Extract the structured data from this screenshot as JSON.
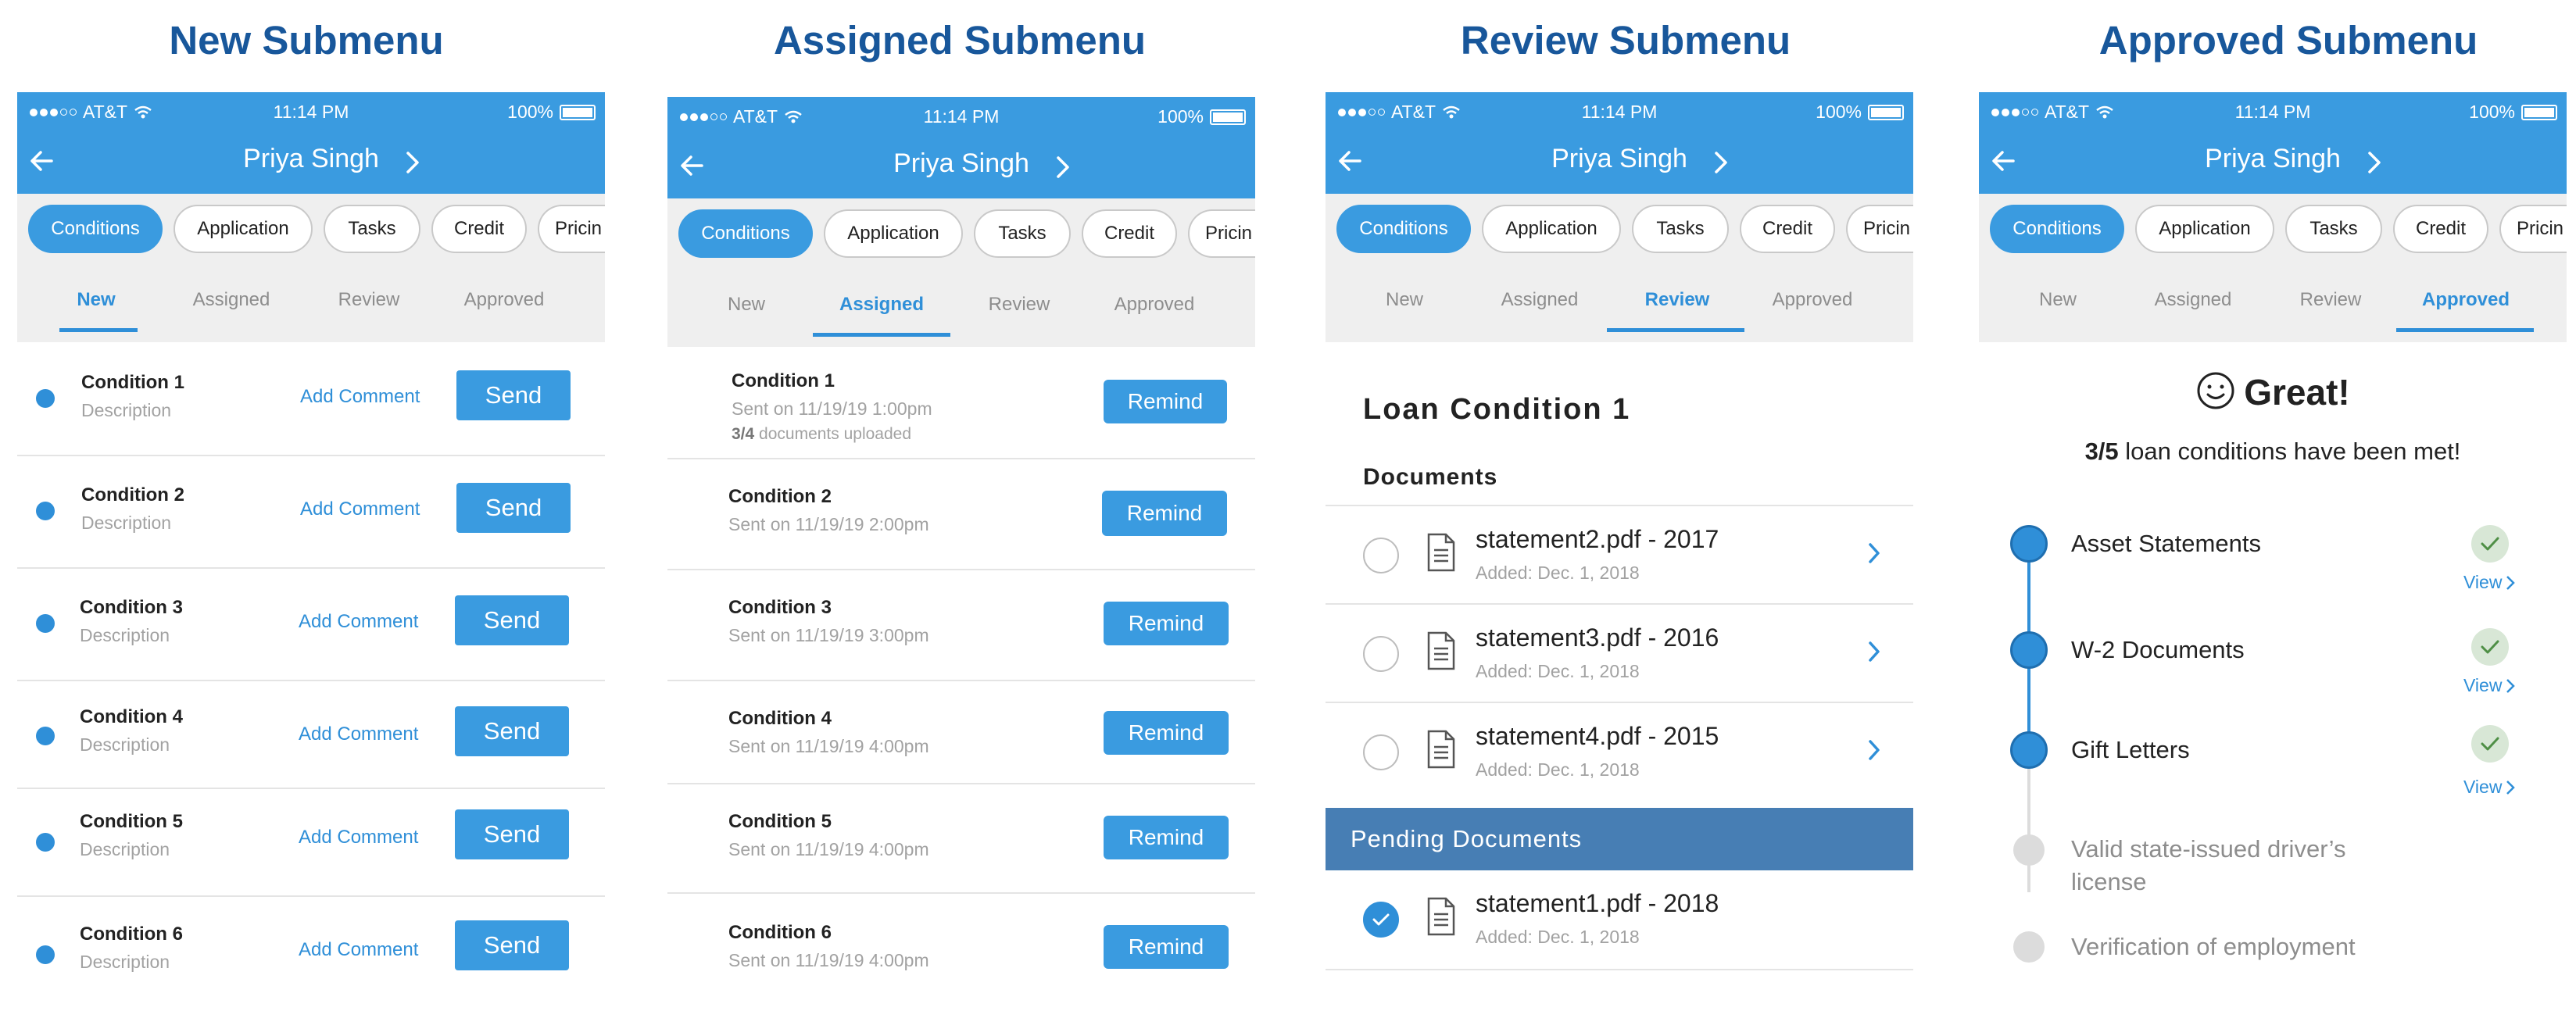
{
  "sections": {
    "new": "New Submenu",
    "assigned": "Assigned Submenu",
    "review": "Review Submenu",
    "approved": "Approved Submenu"
  },
  "status": {
    "carrier": "AT&T",
    "time": "11:14 PM",
    "battery": "100%"
  },
  "header": {
    "name": "Priya Singh"
  },
  "chips": [
    "Conditions",
    "Application",
    "Tasks",
    "Credit",
    "Pricin"
  ],
  "subtabs": [
    "New",
    "Assigned",
    "Review",
    "Approved"
  ],
  "new_panel": {
    "add_comment": "Add Comment",
    "send": "Send",
    "items": [
      {
        "name": "Condition 1",
        "desc": "Description"
      },
      {
        "name": "Condition 2",
        "desc": "Description"
      },
      {
        "name": "Condition 3",
        "desc": "Description"
      },
      {
        "name": "Condition 4",
        "desc": "Description"
      },
      {
        "name": "Condition 5",
        "desc": "Description"
      },
      {
        "name": "Condition 6",
        "desc": "Description"
      }
    ]
  },
  "assigned_panel": {
    "remind": "Remind",
    "items": [
      {
        "name": "Condition 1",
        "sent": "Sent on 11/19/19 1:00pm",
        "count": "3/4",
        "uploaded": "documents uploaded"
      },
      {
        "name": "Condition 2",
        "sent": "Sent on 11/19/19 2:00pm"
      },
      {
        "name": "Condition 3",
        "sent": "Sent on 11/19/19 3:00pm"
      },
      {
        "name": "Condition 4",
        "sent": "Sent on 11/19/19 4:00pm"
      },
      {
        "name": "Condition 5",
        "sent": "Sent on 11/19/19 4:00pm"
      },
      {
        "name": "Condition 6",
        "sent": "Sent on 11/19/19 4:00pm"
      }
    ]
  },
  "review_panel": {
    "title": "Loan Condition 1",
    "documents_header": "Documents",
    "documents": [
      {
        "name": "statement2.pdf - 2017",
        "added": "Added: Dec. 1, 2018"
      },
      {
        "name": "statement3.pdf - 2016",
        "added": "Added: Dec. 1, 2018"
      },
      {
        "name": "statement4.pdf - 2015",
        "added": "Added: Dec. 1, 2018"
      }
    ],
    "pending_header": "Pending Documents",
    "pending": [
      {
        "name": "statement1.pdf - 2018",
        "added": "Added: Dec. 1, 2018",
        "checked": true
      }
    ]
  },
  "approved_panel": {
    "heading": "Great!",
    "met_count": "3/5",
    "met_text": "loan conditions have been met!",
    "view": "View",
    "items": [
      {
        "label": "Asset Statements",
        "done": true
      },
      {
        "label": "W-2 Documents",
        "done": true
      },
      {
        "label": "Gift Letters",
        "done": true
      },
      {
        "label": "Valid state-issued driver’s license",
        "done": false
      },
      {
        "label": "Verification of employment",
        "done": false
      }
    ]
  },
  "colors": {
    "primary": "#3a9be0",
    "title": "#18579b",
    "pending_bar": "#477eb4",
    "check_bg": "#d8e7d6"
  }
}
